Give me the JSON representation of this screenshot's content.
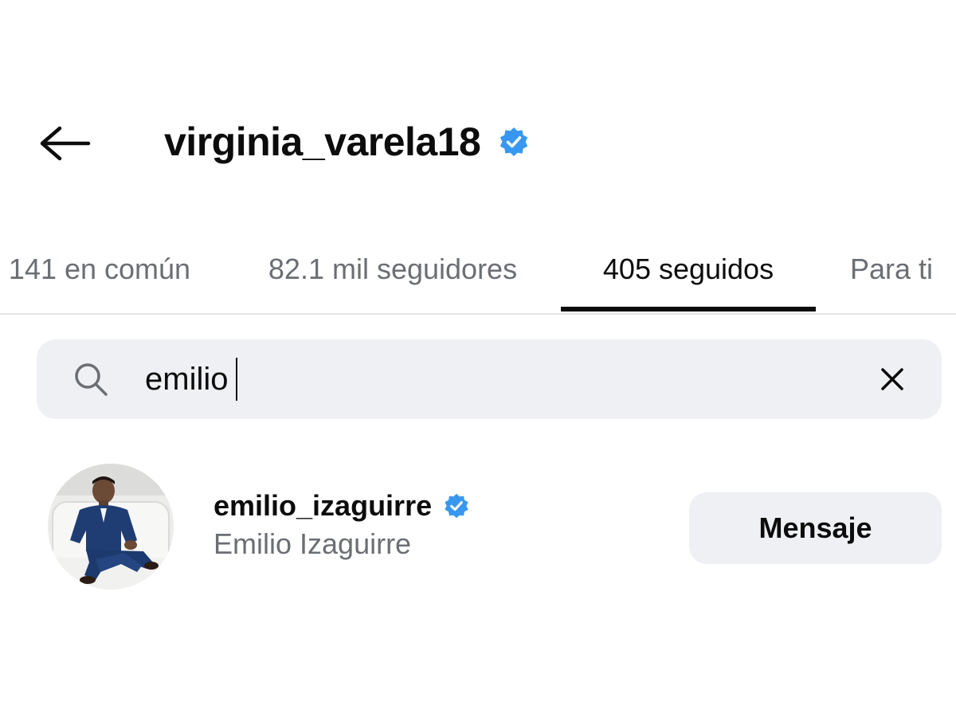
{
  "header": {
    "username": "virginia_varela18",
    "back_icon": "arrow-left-icon",
    "verified_icon": "verified-badge-icon"
  },
  "tabs": [
    {
      "label": "141 en común",
      "active": false
    },
    {
      "label": "82.1 mil seguidores",
      "active": false
    },
    {
      "label": "405 seguidos",
      "active": true
    },
    {
      "label": "Para ti",
      "active": false
    }
  ],
  "search": {
    "value": "emilio",
    "search_icon": "search-icon",
    "clear_icon": "close-icon"
  },
  "results": [
    {
      "username": "emilio_izaguirre",
      "full_name": "Emilio Izaguirre",
      "verified": true,
      "button_label": "Mensaje"
    }
  ],
  "colors": {
    "text_primary": "#0c0c0c",
    "text_secondary": "#6b6e73",
    "verified_blue": "#3897f0",
    "surface": "#eff0f3",
    "divider": "#e3e5e8"
  }
}
